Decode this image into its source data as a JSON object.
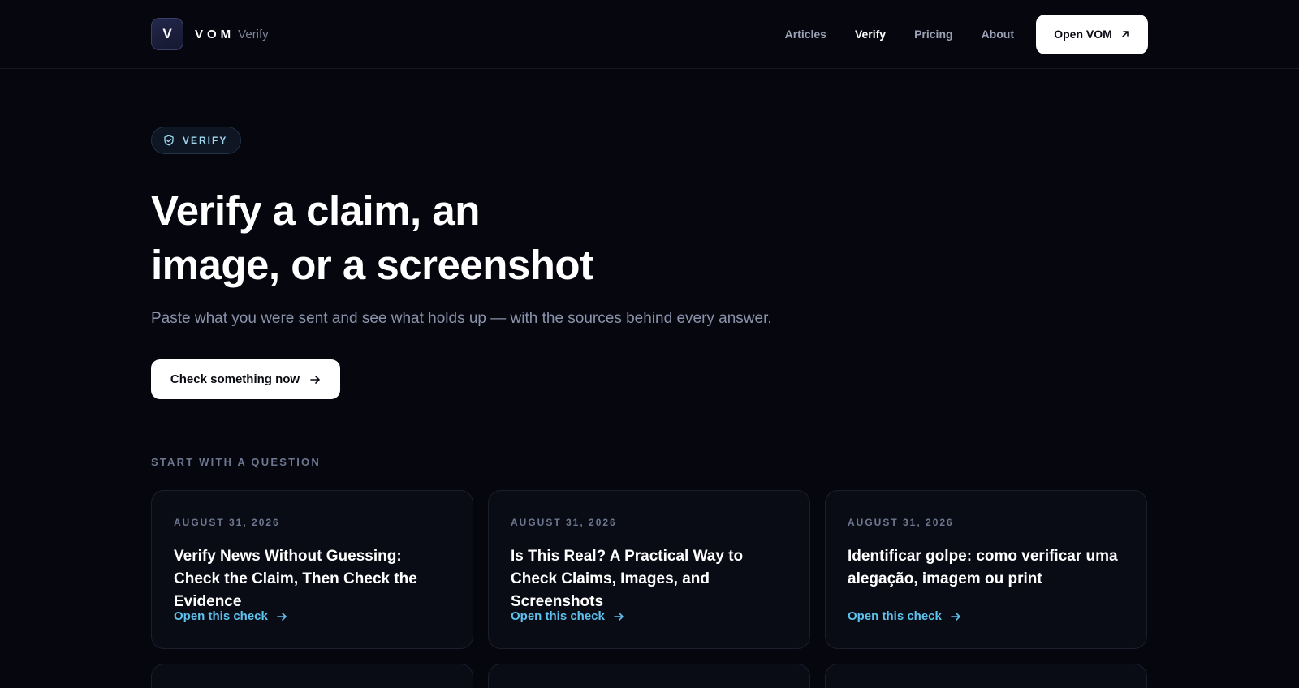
{
  "brand": {
    "logo_letter": "V",
    "name": "VOM",
    "sub": "Verify"
  },
  "nav": {
    "items": [
      {
        "label": "Articles"
      },
      {
        "label": "Verify"
      },
      {
        "label": "Pricing"
      },
      {
        "label": "About"
      }
    ],
    "active": "Verify",
    "cta_label": "Open VOM"
  },
  "hero": {
    "badge_label": "VERIFY",
    "title_line1": "Verify a claim, an",
    "title_line2": "image, or a screenshot",
    "subtitle": "Paste what you were sent and see what holds up — with the sources behind every answer.",
    "cta_label": "Check something now"
  },
  "section": {
    "label": "START WITH A QUESTION"
  },
  "cards": [
    {
      "date": "AUGUST 31, 2026",
      "title": "Verify News Without Guessing: Check the Claim, Then Check the Evidence",
      "link": "Open this check"
    },
    {
      "date": "AUGUST 31, 2026",
      "title": "Is This Real? A Practical Way to Check Claims, Images, and Screenshots",
      "link": "Open this check"
    },
    {
      "date": "AUGUST 31, 2026",
      "title": "Identificar golpe: como verificar uma alegação, imagem ou print",
      "link": "Open this check"
    }
  ],
  "icons": {
    "cta_arrow": "arrow-up-right-icon",
    "badge": "shield-icon",
    "button_arrow": "arrow-right-icon"
  },
  "colors": {
    "background": "#05060e",
    "accent_link": "#5ec2ef",
    "badge_text": "#9fd8ef",
    "button_bg": "#ffffff"
  }
}
